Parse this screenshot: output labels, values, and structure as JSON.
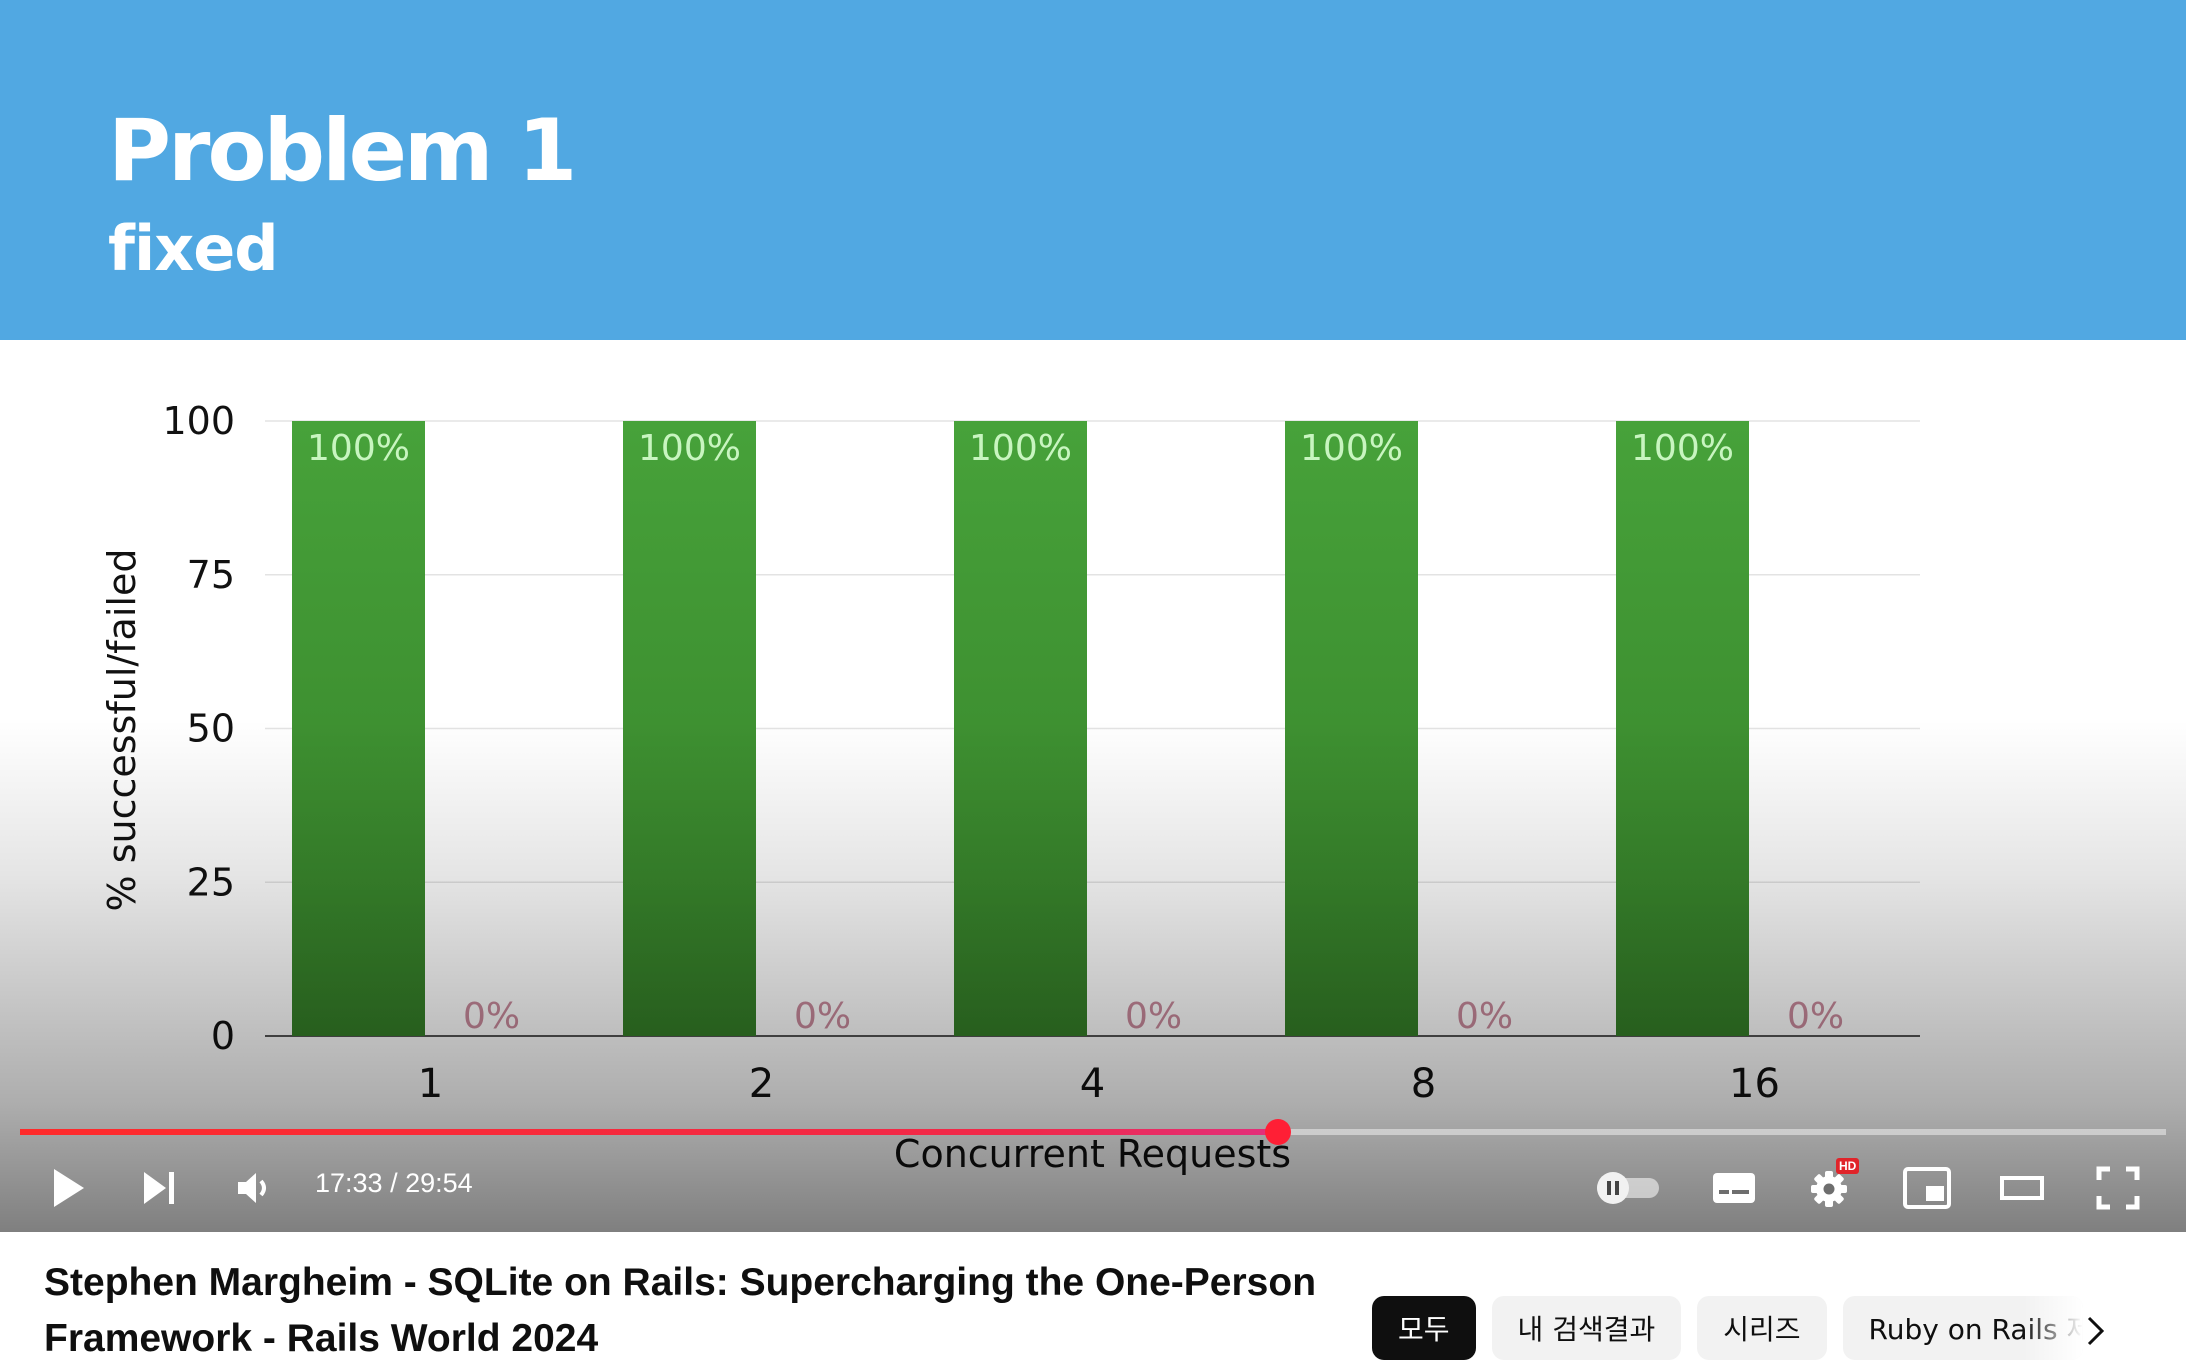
{
  "slide": {
    "title": "Problem 1",
    "subtitle": "fixed",
    "colors": {
      "header": "#51a8e2",
      "success_bar": "#47a03a",
      "failed_label": "#c98a9c",
      "success_label": "#c8f5c0"
    }
  },
  "chart_data": {
    "type": "bar",
    "categories": [
      "1",
      "2",
      "4",
      "8",
      "16"
    ],
    "series": [
      {
        "values": [
          100,
          100,
          100,
          100,
          100
        ],
        "labels": [
          "100%",
          "100%",
          "100%",
          "100%",
          "100%"
        ]
      },
      {
        "values": [
          0,
          0,
          0,
          0,
          0
        ],
        "labels": [
          "0%",
          "0%",
          "0%",
          "0%",
          "0%"
        ]
      }
    ],
    "xlabel": "Concurrent Requests",
    "ylabel": "% successful/failed",
    "ylim": [
      0,
      100
    ],
    "yticks": [
      "0",
      "25",
      "50",
      "75",
      "100"
    ],
    "grid": true
  },
  "player": {
    "time": "17:33 / 29:54",
    "progress_fraction": 0.586,
    "icons": [
      "play-icon",
      "next-icon",
      "volume-icon",
      "autoplay-toggle-icon",
      "subtitles-icon",
      "settings-icon",
      "miniplayer-icon",
      "theater-icon",
      "fullscreen-icon"
    ],
    "settings_badge": "HD",
    "accent": "#ff0000"
  },
  "video": {
    "title": "Stephen Margheim - SQLite on Rails: Supercharging the One-Person Framework - Rails World 2024"
  },
  "chips": [
    {
      "label": "모두",
      "active": true
    },
    {
      "label": "내 검색결과",
      "active": false
    },
    {
      "label": "시리즈",
      "active": false
    },
    {
      "label": "Ruby on Rails 제",
      "active": false
    }
  ]
}
